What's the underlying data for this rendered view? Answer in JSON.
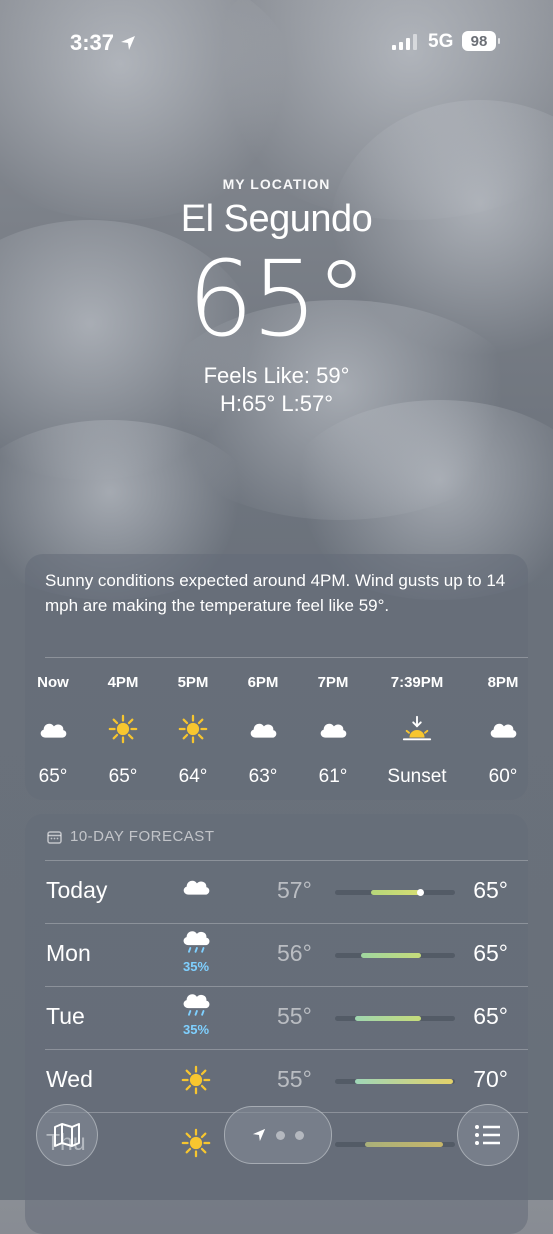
{
  "status_bar": {
    "time": "3:37",
    "network": "5G",
    "battery": "98"
  },
  "header": {
    "location_label": "MY LOCATION",
    "city": "El Segundo",
    "temperature": "65°",
    "feels_like": "Feels Like: 59°",
    "high_low": "H:65°  L:57°"
  },
  "hourly": {
    "summary": "Sunny conditions expected around 4PM. Wind gusts up to 14 mph are making the temperature feel like 59°.",
    "hours": [
      {
        "label": "Now",
        "icon": "cloud-icon",
        "value": "65°"
      },
      {
        "label": "4PM",
        "icon": "sun-icon",
        "value": "65°"
      },
      {
        "label": "5PM",
        "icon": "sun-icon",
        "value": "64°"
      },
      {
        "label": "6PM",
        "icon": "cloud-icon",
        "value": "63°"
      },
      {
        "label": "7PM",
        "icon": "cloud-icon",
        "value": "61°"
      },
      {
        "label": "7:39PM",
        "icon": "sunset-icon",
        "value": "Sunset"
      },
      {
        "label": "8PM",
        "icon": "cloud-icon",
        "value": "60°"
      }
    ]
  },
  "forecast": {
    "title": "10-DAY FORECAST",
    "days": [
      {
        "day": "Today",
        "icon": "cloud-icon",
        "precip": "",
        "low": "57°",
        "high": "65°",
        "range_start": 0.3,
        "range_end": 0.72,
        "current": 0.72,
        "gradient": [
          "#b6d67a",
          "#d6de73"
        ]
      },
      {
        "day": "Mon",
        "icon": "cloud-rain-icon",
        "precip": "35%",
        "low": "56°",
        "high": "65°",
        "range_start": 0.22,
        "range_end": 0.72,
        "gradient": [
          "#9fd6a0",
          "#c6dc7a"
        ]
      },
      {
        "day": "Tue",
        "icon": "cloud-rain-icon",
        "precip": "35%",
        "low": "55°",
        "high": "65°",
        "range_start": 0.17,
        "range_end": 0.72,
        "gradient": [
          "#9fd6b0",
          "#c6dc7a"
        ]
      },
      {
        "day": "Wed",
        "icon": "sun-icon",
        "precip": "",
        "low": "55°",
        "high": "70°",
        "range_start": 0.17,
        "range_end": 0.98,
        "gradient": [
          "#9fd6b8",
          "#e4d26a"
        ]
      },
      {
        "day": "Thu",
        "icon": "sun-icon",
        "precip": "",
        "low": "",
        "high": "",
        "range_start": 0.25,
        "range_end": 0.9,
        "gradient": [
          "#a9b07a",
          "#c7b66a"
        ]
      }
    ]
  },
  "toolbar": {
    "map": "map-icon",
    "location": "location-arrow-icon",
    "list": "list-icon"
  },
  "colors": {
    "sun": "#f7c62f",
    "precip": "#7fd0ff"
  }
}
